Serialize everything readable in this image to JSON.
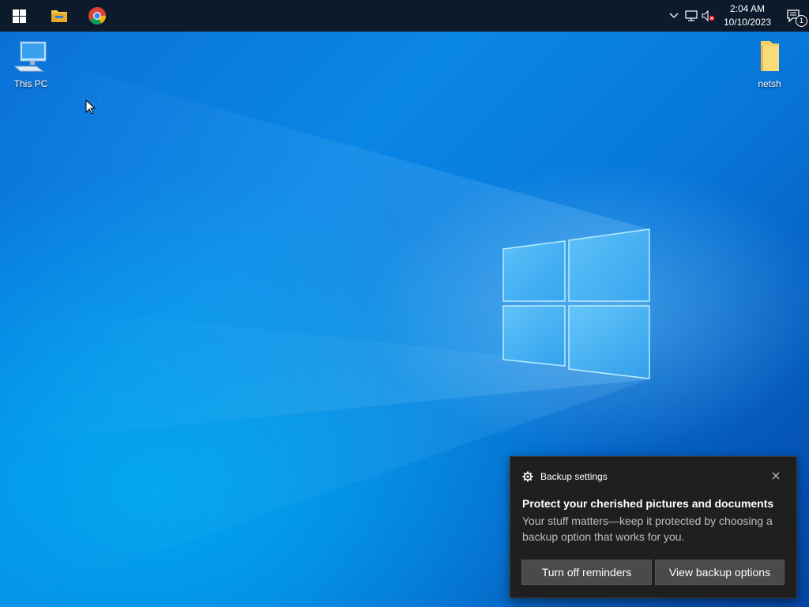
{
  "taskbar": {
    "pinned": [
      {
        "name": "start",
        "icon": "windows-logo-icon"
      },
      {
        "name": "file-explorer",
        "icon": "folder-icon"
      },
      {
        "name": "chrome",
        "icon": "chrome-icon"
      }
    ],
    "tray": {
      "icons": [
        "chevron-up-icon",
        "network-icon",
        "volume-muted-icon"
      ],
      "time": "2:04 AM",
      "date": "10/10/2023",
      "notification_count": "1"
    },
    "colors": {
      "background": "#0c1a2b"
    }
  },
  "desktop": {
    "icons": [
      {
        "label": "This PC",
        "icon": "computer-icon"
      },
      {
        "label": "netsh",
        "icon": "folder-icon"
      }
    ],
    "wallpaper": "windows-10-hero"
  },
  "toast": {
    "app": "Backup settings",
    "app_icon": "gear-icon",
    "title": "Protect your cherished pictures and documents",
    "body": "Your stuff matters—keep it protected by choosing a backup option that works for you.",
    "buttons": {
      "turn_off": "Turn off reminders",
      "view_options": "View backup options"
    },
    "colors": {
      "background": "#1f1f1f",
      "button": "#4a4a4a"
    }
  }
}
